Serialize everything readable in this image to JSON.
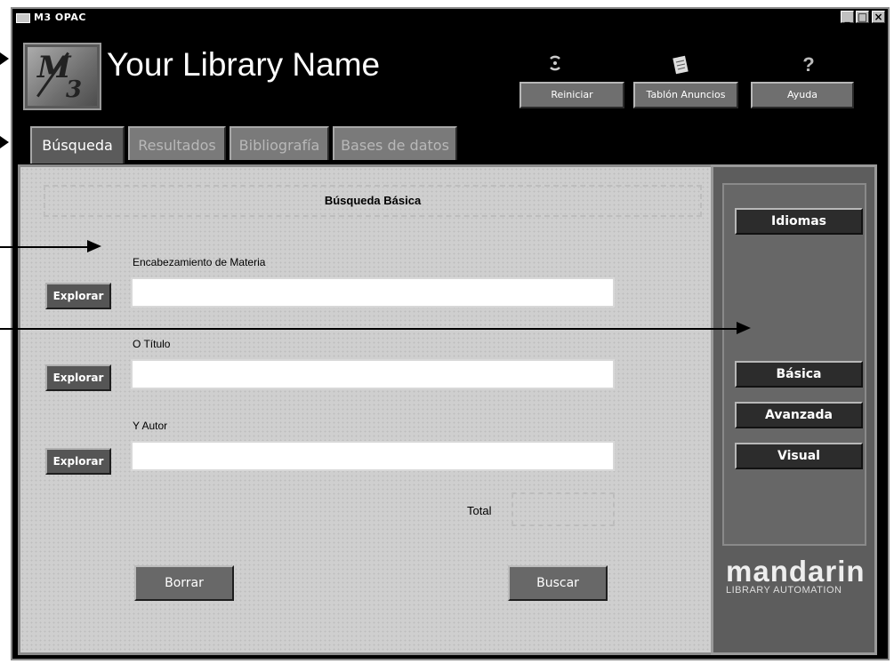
{
  "window": {
    "title": "M3 OPAC",
    "minimize": "_",
    "maximize": "□",
    "close": "×"
  },
  "header": {
    "logo_text_m": "M",
    "logo_text_3": "3",
    "library_name": "Your Library Name",
    "buttons": [
      {
        "label": "Reiniciar",
        "icon": "reset-icon"
      },
      {
        "label": "Tablón Anuncios",
        "icon": "notice-board-icon"
      },
      {
        "label": "Ayuda",
        "icon": "help-icon"
      }
    ],
    "help_glyph": "?"
  },
  "tabs": [
    {
      "label": "Búsqueda",
      "active": true
    },
    {
      "label": "Resultados",
      "active": false
    },
    {
      "label": "Bibliografía",
      "active": false
    },
    {
      "label": "Bases de datos",
      "active": false
    }
  ],
  "search": {
    "heading": "Búsqueda Básica",
    "fields": [
      {
        "label": "Encabezamiento de Materia",
        "value": "",
        "browse": "Explorar"
      },
      {
        "label": "O Título",
        "value": "",
        "browse": "Explorar"
      },
      {
        "label": "Y Autor",
        "value": "",
        "browse": "Explorar"
      }
    ],
    "total_label": "Total",
    "total_value": "",
    "clear_label": "Borrar",
    "search_label": "Buscar"
  },
  "sidebar": {
    "languages": "Idiomas",
    "modes": [
      "Básica",
      "Avanzada",
      "Visual"
    ],
    "brand_main": "mandarin",
    "brand_sub": "LIBRARY AUTOMATION"
  },
  "colors": {
    "background": "#000000",
    "panel": "#cfcfcf",
    "sidebar": "#5d5d5d"
  }
}
